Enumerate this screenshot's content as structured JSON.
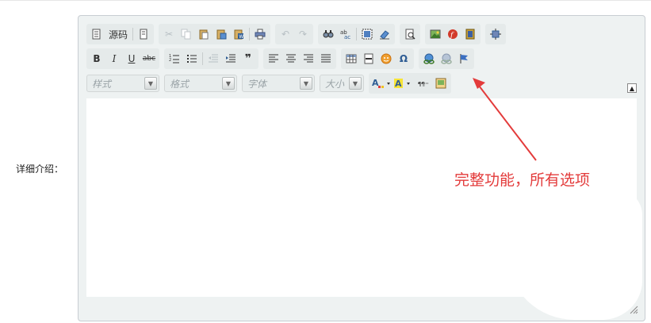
{
  "field": {
    "label": "详细介绍："
  },
  "editor": {
    "source_label": "源码",
    "combos": [
      {
        "id": "style",
        "placeholder": "样式"
      },
      {
        "id": "format",
        "placeholder": "格式"
      },
      {
        "id": "font",
        "placeholder": "字体"
      },
      {
        "id": "size",
        "placeholder": "大小"
      }
    ]
  },
  "annotation": {
    "text": "完整功能，所有选项",
    "color": "#e33b3b"
  },
  "colors": {
    "frame_bg": "#eef2f2",
    "toolbar_group": "#e5eaea",
    "annotation": "#e33b3b"
  }
}
